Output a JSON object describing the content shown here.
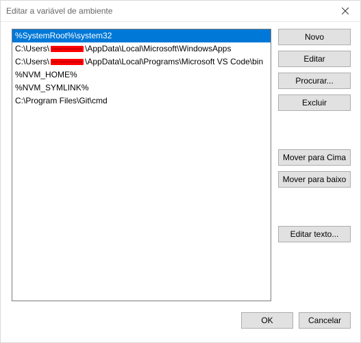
{
  "window": {
    "title": "Editar a variável de ambiente"
  },
  "path_entries": [
    {
      "selected": true,
      "pre": "%SystemRoot%\\system32",
      "redacted": false,
      "post": ""
    },
    {
      "selected": false,
      "pre": "C:\\Users\\",
      "redacted": true,
      "post": "\\AppData\\Local\\Microsoft\\WindowsApps"
    },
    {
      "selected": false,
      "pre": "C:\\Users\\",
      "redacted": true,
      "post": "\\AppData\\Local\\Programs\\Microsoft VS Code\\bin"
    },
    {
      "selected": false,
      "pre": "%NVM_HOME%",
      "redacted": false,
      "post": ""
    },
    {
      "selected": false,
      "pre": "%NVM_SYMLINK%",
      "redacted": false,
      "post": ""
    },
    {
      "selected": false,
      "pre": "C:\\Program Files\\Git\\cmd",
      "redacted": false,
      "post": ""
    }
  ],
  "buttons": {
    "novo": "Novo",
    "editar": "Editar",
    "procurar": "Procurar...",
    "excluir": "Excluir",
    "mover_cima": "Mover para Cima",
    "mover_baixo": "Mover para baixo",
    "editar_texto": "Editar texto...",
    "ok": "OK",
    "cancelar": "Cancelar"
  }
}
